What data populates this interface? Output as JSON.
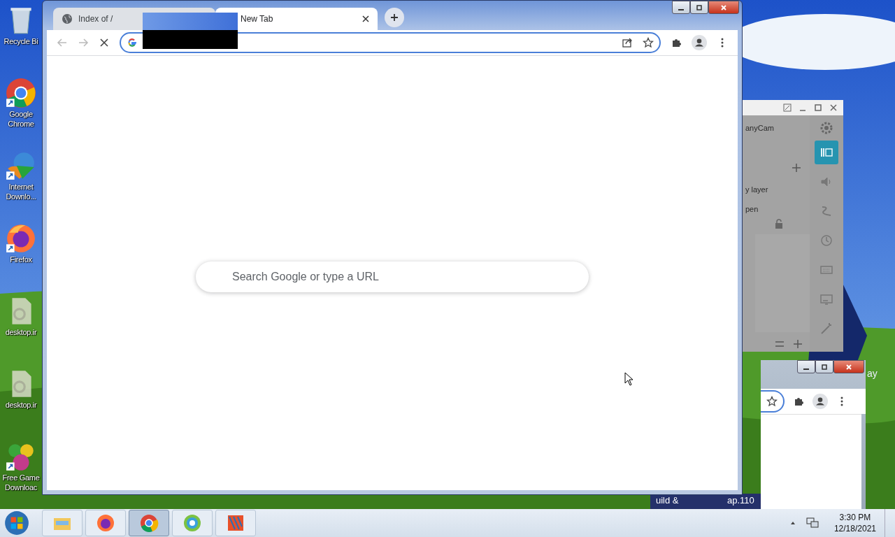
{
  "desktop": {
    "icons": [
      {
        "kind": "recycle",
        "label": "Recycle Bi"
      },
      {
        "kind": "chrome",
        "label": "Google Chrome"
      },
      {
        "kind": "downloader",
        "label": "Internet Downlo..."
      },
      {
        "kind": "firefox",
        "label": "Firefox"
      },
      {
        "kind": "file",
        "label": "desktop.ir"
      },
      {
        "kind": "file",
        "label": "desktop.ir"
      },
      {
        "kind": "games",
        "label": "Free Game Downloac"
      }
    ],
    "partial_texts": [
      {
        "text": "ay"
      },
      {
        "text": "uild &"
      },
      {
        "text": "ap.110"
      }
    ]
  },
  "browser": {
    "tabs": [
      {
        "label": "Index of /",
        "selected": false
      },
      {
        "label": "New Tab",
        "selected": true
      }
    ],
    "loading": true,
    "search": {
      "placeholder": "Search Google or type a URL"
    }
  },
  "camera_window": {
    "labels": [
      {
        "text": "anyCam"
      },
      {
        "text": "y layer"
      },
      {
        "text": "pen"
      }
    ],
    "tools": [
      {
        "kind": "layers",
        "selected": true
      },
      {
        "kind": "sound",
        "selected": false
      },
      {
        "kind": "draw",
        "selected": false
      },
      {
        "kind": "clock",
        "selected": false
      },
      {
        "kind": "keyboard",
        "selected": false
      },
      {
        "kind": "screen",
        "selected": false
      },
      {
        "kind": "wand",
        "selected": false
      }
    ]
  },
  "taskbar": {
    "apps": [
      {
        "kind": "explorer",
        "selected": false
      },
      {
        "kind": "firefox",
        "selected": false
      },
      {
        "kind": "chrome",
        "selected": true
      },
      {
        "kind": "camera",
        "selected": false
      },
      {
        "kind": "antivirus",
        "selected": false
      }
    ],
    "time": "3:30 PM",
    "date": "12/18/2021"
  }
}
